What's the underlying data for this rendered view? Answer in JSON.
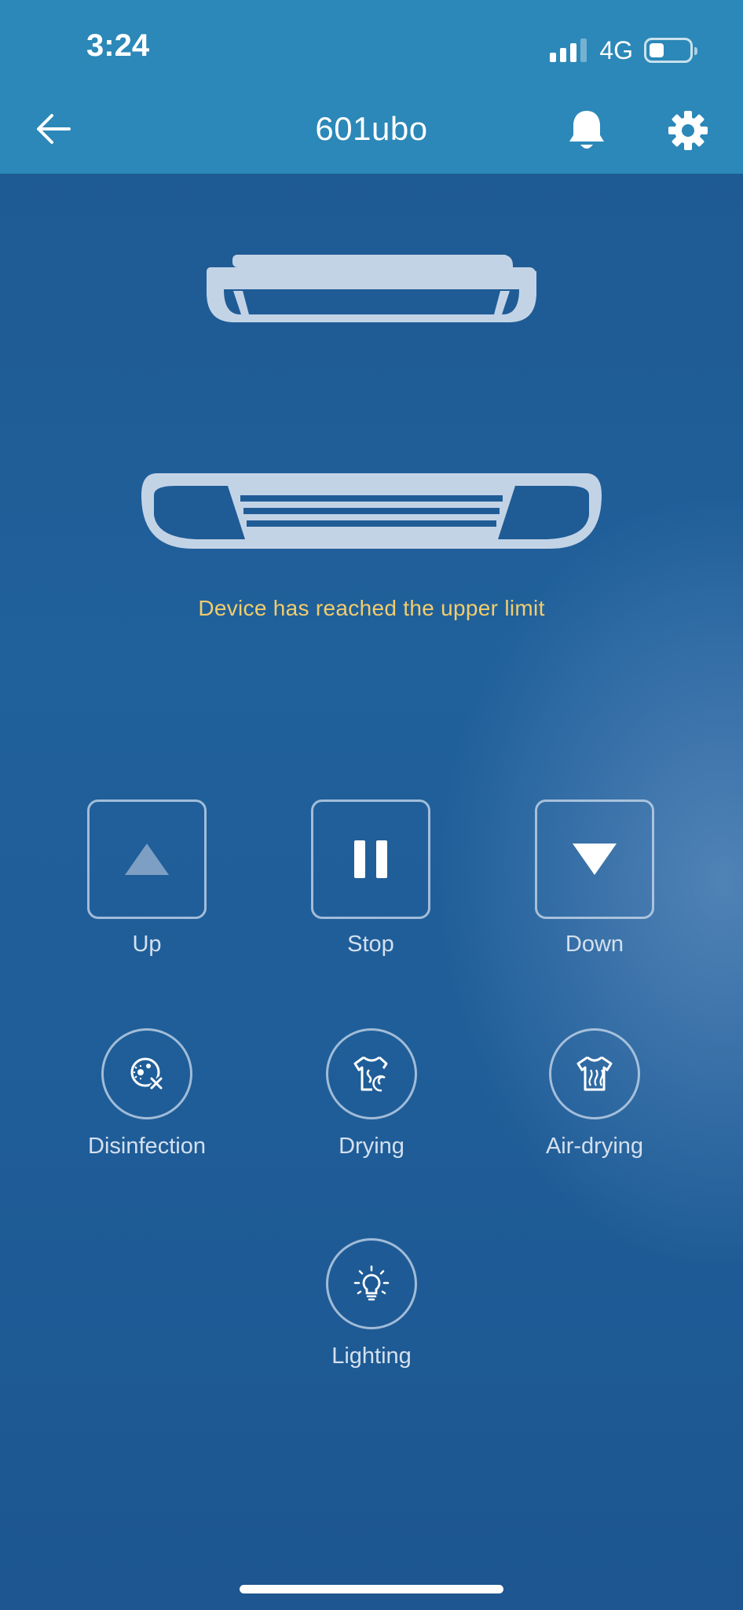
{
  "status_bar": {
    "time": "3:24",
    "network": "4G",
    "signal_bars": 3,
    "battery_level": 0.3
  },
  "header": {
    "title": "601ubo",
    "back_icon": "arrow-left-icon",
    "notification_icon": "bell-icon",
    "settings_icon": "gear-icon"
  },
  "device": {
    "status_message": "Device has reached the upper limit"
  },
  "controls": {
    "up": {
      "label": "Up",
      "icon": "triangle-up-icon"
    },
    "stop": {
      "label": "Stop",
      "icon": "pause-icon"
    },
    "down": {
      "label": "Down",
      "icon": "triangle-down-icon"
    }
  },
  "modes": {
    "disinfection": {
      "label": "Disinfection",
      "icon": "disinfection-icon"
    },
    "drying": {
      "label": "Drying",
      "icon": "drying-shirt-icon"
    },
    "air_drying": {
      "label": "Air-drying",
      "icon": "air-drying-shirt-icon"
    },
    "lighting": {
      "label": "Lighting",
      "icon": "light-bulb-icon"
    }
  },
  "colors": {
    "header_bg": "#2b88b8",
    "background": "#1f5d98",
    "warning_text": "#f2cd6b",
    "label_text": "#d4e0ef"
  }
}
